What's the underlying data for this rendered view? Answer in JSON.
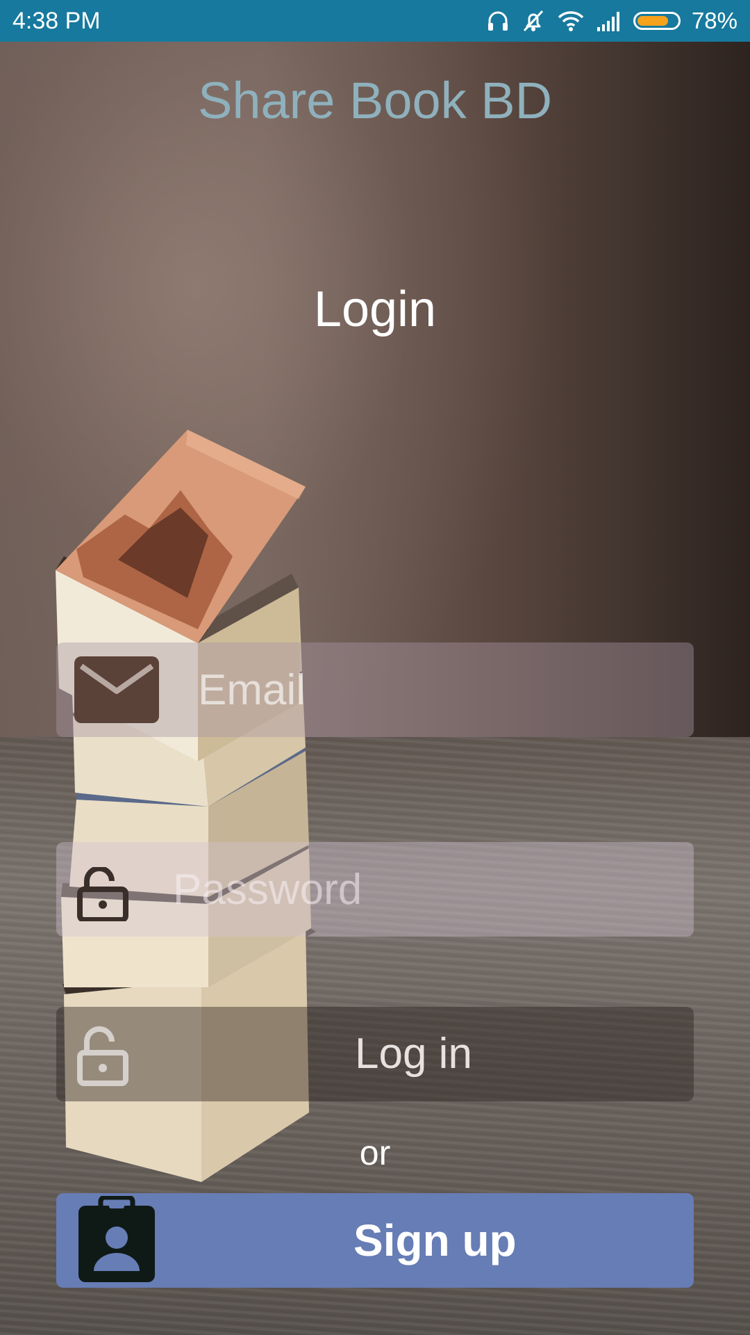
{
  "status_bar": {
    "time": "4:38 PM",
    "battery_percent": "78%",
    "battery_level": 0.78,
    "battery_color": "#f7a21b",
    "background_color": "#17799e",
    "icons": [
      "headset-icon",
      "mute-icon",
      "wifi-icon",
      "signal-icon",
      "battery-icon"
    ]
  },
  "app": {
    "title": "Share Book BD",
    "title_color": "#8fb1bd"
  },
  "screen": {
    "title": "Login"
  },
  "form": {
    "email": {
      "placeholder": "Email",
      "value": "",
      "icon": "email-icon"
    },
    "password": {
      "placeholder": "Password",
      "value": "",
      "icon": "lock-icon"
    }
  },
  "actions": {
    "login_label": "Log in",
    "login_icon": "lock-icon",
    "separator": "or",
    "signup_label": "Sign up",
    "signup_icon": "contact-badge-icon",
    "signup_color": "#677db5"
  }
}
